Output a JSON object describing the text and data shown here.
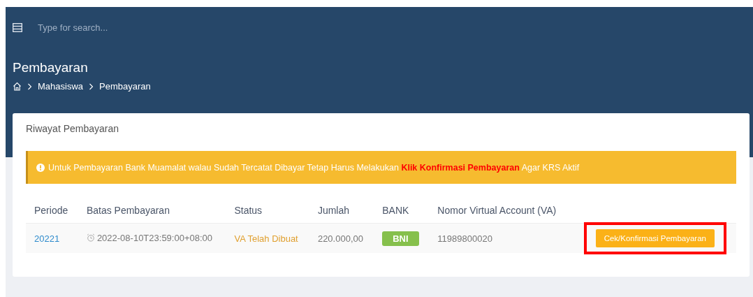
{
  "search": {
    "placeholder": "Type for search..."
  },
  "page_title": "Pembayaran",
  "breadcrumb": [
    "Mahasiswa",
    "Pembayaran"
  ],
  "card_title": "Riwayat Pembayaran",
  "alert": "Untuk Pembayaran Bank Muamalat walau Sudah Tercatat Dibayar Tetap Harus Melakukan **Klik Konfirmasi Pembayaran** Agar KRS Aktif",
  "table": {
    "columns": [
      "Periode",
      "Batas Pembayaran",
      "Status",
      "Jumlah",
      "BANK",
      "Nomor Virtual Account (VA)"
    ],
    "rows": [
      {
        "periode": "20221",
        "batas": "2022-08-10T23:59:00+08:00",
        "status": "VA Telah Dibuat",
        "jumlah": "220.000,00",
        "bank": "BNI",
        "va": "11989800020",
        "action": "Cek/Konfirmasi Pembayaran",
        "highlighted": true
      }
    ]
  }
}
